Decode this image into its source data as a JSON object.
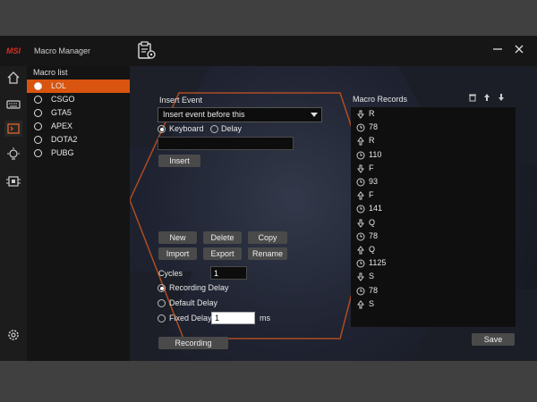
{
  "app": {
    "logo": "MSI",
    "title": "Macro Manager"
  },
  "macro_list": {
    "title": "Macro list",
    "items": [
      "LOL",
      "CSGO",
      "GTA5",
      "APEX",
      "DOTA2",
      "PUBG"
    ],
    "selected": "LOL"
  },
  "insert_event": {
    "title": "Insert Event",
    "dropdown_value": "Insert event before this",
    "option_keyboard": "Keyboard",
    "option_delay": "Delay",
    "selected_option": "Keyboard",
    "key_value": "",
    "insert_label": "Insert"
  },
  "actions": {
    "new_label": "New",
    "delete_label": "Delete",
    "copy_label": "Copy",
    "import_label": "Import",
    "export_label": "Export",
    "rename_label": "Rename"
  },
  "settings": {
    "cycles_label": "Cycles",
    "cycles_value": "1",
    "recording_delay_label": "Recording Delay",
    "default_delay_label": "Default Delay",
    "fixed_delay_label": "Fixed Delay",
    "fixed_delay_value": "1",
    "unit_label": "ms",
    "selected_mode": "Recording Delay"
  },
  "recording_label": "Recording",
  "save_label": "Save",
  "records": {
    "title": "Macro Records",
    "rows": [
      {
        "icon": "key-down-icon",
        "value": "R"
      },
      {
        "icon": "delay-icon",
        "value": "78"
      },
      {
        "icon": "key-up-icon",
        "value": "R"
      },
      {
        "icon": "delay-icon",
        "value": "110"
      },
      {
        "icon": "key-down-icon",
        "value": "F"
      },
      {
        "icon": "delay-icon",
        "value": "93"
      },
      {
        "icon": "key-up-icon",
        "value": "F"
      },
      {
        "icon": "delay-icon",
        "value": "141"
      },
      {
        "icon": "key-down-icon",
        "value": "Q"
      },
      {
        "icon": "delay-icon",
        "value": "78"
      },
      {
        "icon": "key-up-icon",
        "value": "Q"
      },
      {
        "icon": "delay-icon",
        "value": "1125"
      },
      {
        "icon": "key-down-icon",
        "value": "S"
      },
      {
        "icon": "delay-icon",
        "value": "78"
      },
      {
        "icon": "key-up-icon",
        "value": "S"
      }
    ]
  },
  "colors": {
    "accent": "#d9540f",
    "hexagon": "#c8541e",
    "background": "#151515"
  }
}
